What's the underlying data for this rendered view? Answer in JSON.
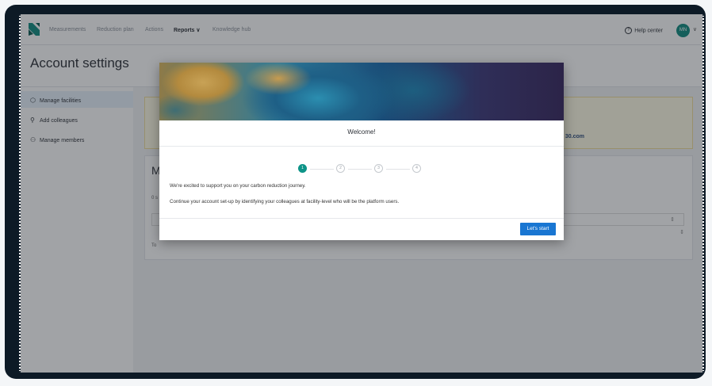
{
  "nav": {
    "items": [
      "Measurements",
      "Reduction plan",
      "Actions",
      "Reports",
      "Knowledge hub"
    ],
    "active_chevron": "∨",
    "help_label": "Help center",
    "help_icon": "question-circle-icon",
    "avatar_initials": "MN",
    "brand_color": "#0e8a7e"
  },
  "page": {
    "title": "Account settings"
  },
  "sidebar": {
    "items": [
      {
        "label": "Manage facilities",
        "icon": "building-icon"
      },
      {
        "label": "Add colleagues",
        "icon": "person-icon"
      },
      {
        "label": "Manage members",
        "icon": "people-icon"
      }
    ]
  },
  "background": {
    "info_link_fragment": "30.com",
    "card_heading_fragment": "M",
    "card_line_fragment": "0 s",
    "card_footer_fragment": "To"
  },
  "modal": {
    "title": "Welcome!",
    "steps": [
      "1",
      "2",
      "3",
      "4"
    ],
    "current_step": 1,
    "message_1": "We're excited to support you on your carbon reduction journey.",
    "message_2": "Continue your account set-up by identifying your colleagues at facility-level who will be the platform users.",
    "start_label": "Let's start",
    "accent_color": "#0e9488",
    "button_color": "#1976d2"
  }
}
